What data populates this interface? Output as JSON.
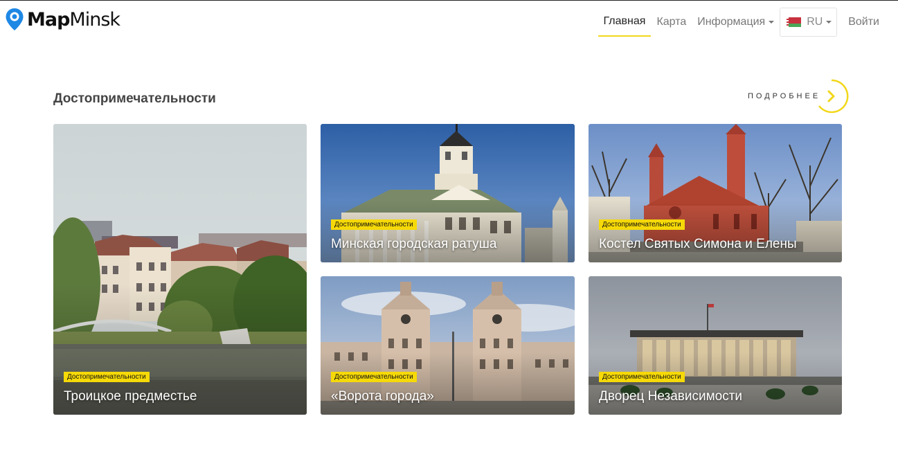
{
  "brand": {
    "name_bold": "Map",
    "name_light": "Minsk"
  },
  "nav": {
    "items": [
      {
        "label": "Главная",
        "active": true
      },
      {
        "label": "Карта",
        "active": false
      },
      {
        "label": "Информация",
        "active": false
      }
    ],
    "language": "RU",
    "login": "Войти"
  },
  "section": {
    "title": "Достопримечательности",
    "more_label": "ПОДРОБНЕЕ"
  },
  "cards": [
    {
      "tag": "Достопримечательности",
      "title": "Троицкое предместье"
    },
    {
      "tag": "Достопримечательности",
      "title": "Минская городская ратуша"
    },
    {
      "tag": "Достопримечательности",
      "title": "Костел Святых Симона и Елены"
    },
    {
      "tag": "Достопримечательности",
      "title": "«Ворота города»"
    },
    {
      "tag": "Достопримечательности",
      "title": "Дворец Независимости"
    }
  ],
  "colors": {
    "accent": "#f2d71a",
    "badge": "#f6d908",
    "logo_blue": "#1e88e5"
  }
}
